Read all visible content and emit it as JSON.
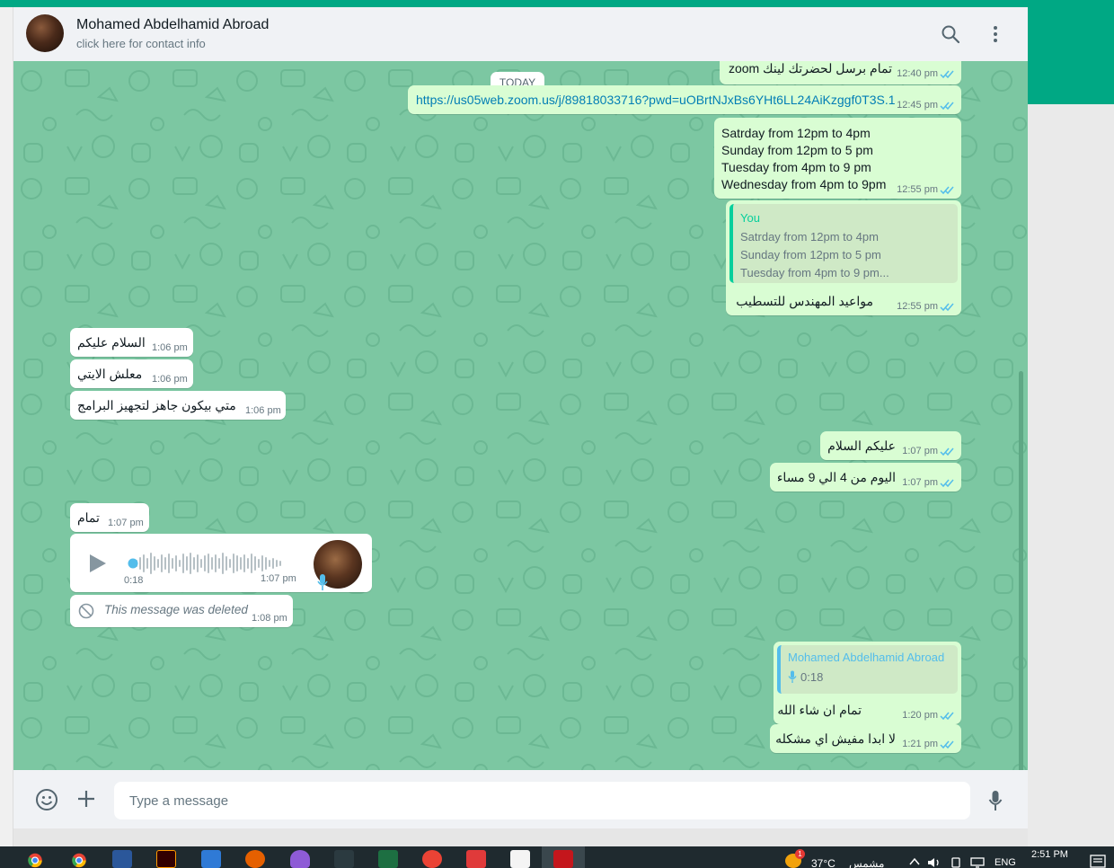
{
  "header": {
    "contact_name": "Mohamed Abdelhamid Abroad",
    "contact_sub": "click here for contact info",
    "search_icon": "search-icon",
    "menu_icon": "kebab-menu-icon"
  },
  "date_chip": "TODAY",
  "messages": {
    "m1": {
      "text": "تمام برسل لحضرتك لينك zoom",
      "time": "12:40 pm"
    },
    "m2": {
      "text": "https://us05web.zoom.us/j/89818033716?pwd=uOBrtNJxBs6YHt6LL24AiKzggf0T3S.1",
      "time": "12:45 pm"
    },
    "m3": {
      "lines": [
        "Satrday from 12pm to 4pm",
        "Sunday from 12pm to 5 pm",
        "Tuesday from 4pm to 9 pm",
        "Wednesday from 4pm to 9pm"
      ],
      "time": "12:55 pm"
    },
    "m4": {
      "quote_author": "You",
      "quote_lines": [
        "Satrday from 12pm to 4pm",
        "Sunday from 12pm to 5 pm",
        "Tuesday from 4pm to 9 pm..."
      ],
      "text": "مواعيد المهندس للتسطيب",
      "time": "12:55 pm"
    },
    "m5": {
      "text": "السلام عليكم",
      "time": "1:06 pm"
    },
    "m6": {
      "text": "معلش الايتي",
      "time": "1:06 pm"
    },
    "m7": {
      "text": "متي بيكون جاهز  لتجهيز البرامج",
      "time": "1:06 pm"
    },
    "m8": {
      "text": "عليكم السلام",
      "time": "1:07 pm"
    },
    "m9": {
      "text": "اليوم من 4 الي 9 مساء",
      "time": "1:07 pm"
    },
    "m10": {
      "text": "تمام",
      "time": "1:07 pm"
    },
    "m11": {
      "duration": "0:18",
      "time": "1:07 pm",
      "play_icon": "play-icon",
      "mic_icon": "microphone-icon"
    },
    "m12": {
      "text": "This message was deleted",
      "time": "1:08 pm",
      "icon": "blocked-icon"
    },
    "m13": {
      "quote_author": "Mohamed Abdelhamid Abroad",
      "quote_duration": "0:18",
      "text": "تمام ان شاء الله",
      "time": "1:20 pm"
    },
    "m14": {
      "text": "لا ابدا مفيش اي مشكله",
      "time": "1:21 pm"
    }
  },
  "composer": {
    "placeholder": "Type a message",
    "emoji_icon": "emoji-icon",
    "attach_icon": "plus-icon",
    "mic_icon": "microphone-icon"
  },
  "taskbar": {
    "weather": "37°C",
    "weather_label": "مشمس",
    "lang": "ENG",
    "clock": "2:51 PM",
    "notification_count": "1"
  },
  "colors": {
    "brand": "#00a884",
    "chat_bg": "#7cc7a2",
    "outgoing": "#d9fdd3",
    "incoming": "#ffffff",
    "read_ticks": "#53bdeb",
    "link": "#027eb5"
  }
}
